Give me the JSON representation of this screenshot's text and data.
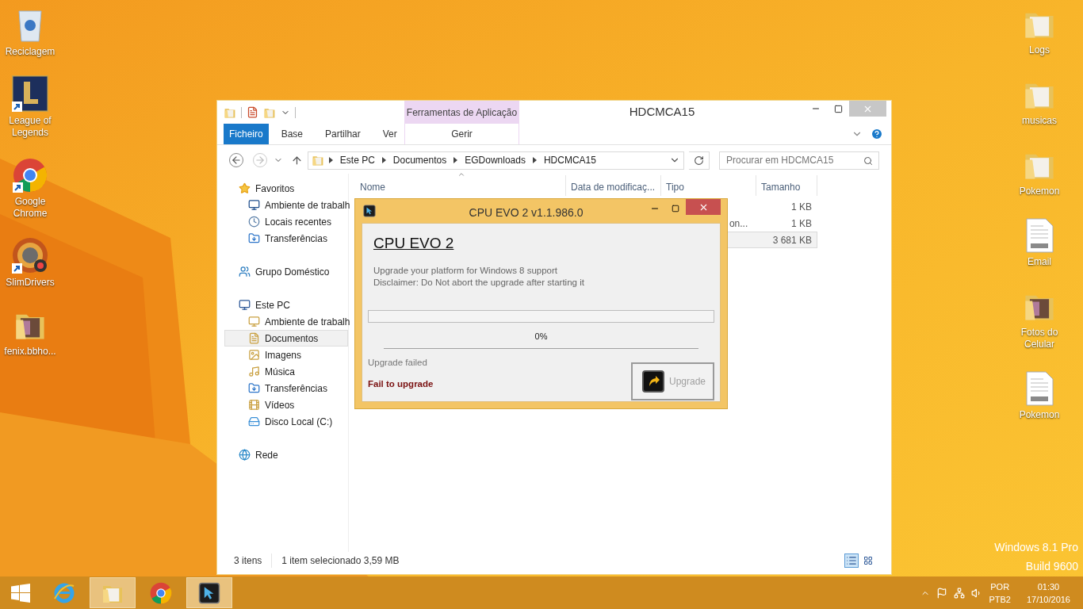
{
  "desktop_left": [
    {
      "label": "Reciclagem",
      "kind": "recycle-bin",
      "shortcut": false
    },
    {
      "label": "League of Legends",
      "kind": "game",
      "shortcut": true
    },
    {
      "label": "Google Chrome",
      "kind": "chrome",
      "shortcut": true
    },
    {
      "label": "SlimDrivers",
      "kind": "app",
      "shortcut": true
    },
    {
      "label": "fenix.bbho...",
      "kind": "photo-folder",
      "shortcut": false
    }
  ],
  "desktop_right": [
    {
      "label": "Logs",
      "kind": "folder",
      "shortcut": false
    },
    {
      "label": "musicas",
      "kind": "folder",
      "shortcut": false
    },
    {
      "label": "Pokemon",
      "kind": "folder",
      "shortcut": false
    },
    {
      "label": "Email",
      "kind": "document",
      "shortcut": false
    },
    {
      "label": "Fotos do Celular",
      "kind": "photo-folder",
      "shortcut": false
    },
    {
      "label": "Pokemon",
      "kind": "document",
      "shortcut": false
    }
  ],
  "explorer": {
    "title": "HDCMCA15",
    "context_group": "Ferramentas de Aplicação",
    "ribbon_tabs": [
      {
        "label": "Ficheiro",
        "kind": "file"
      },
      {
        "label": "Base",
        "kind": "tab"
      },
      {
        "label": "Partilhar",
        "kind": "tab"
      },
      {
        "label": "Ver",
        "kind": "tab"
      },
      {
        "label": "Gerir",
        "kind": "context"
      }
    ],
    "breadcrumb": [
      "Este PC",
      "Documentos",
      "EGDownloads",
      "HDCMCA15"
    ],
    "search": {
      "placeholder": "Procurar em HDCMCA15"
    },
    "sidebar": [
      {
        "label": "Favoritos",
        "kind": "favorites",
        "selected": false,
        "children": [
          {
            "label": "Ambiente de trabalh",
            "kind": "desktop",
            "selected": false
          },
          {
            "label": "Locais recentes",
            "kind": "recent",
            "selected": false
          },
          {
            "label": "Transferências",
            "kind": "downloads",
            "selected": false
          }
        ]
      },
      {
        "label": "Grupo Doméstico",
        "kind": "homegroup",
        "selected": false
      },
      {
        "label": "Este PC",
        "kind": "pc",
        "selected": false,
        "children": [
          {
            "label": "Ambiente de trabalh",
            "kind": "desktop-folder",
            "selected": false
          },
          {
            "label": "Documentos",
            "kind": "documents",
            "selected": true
          },
          {
            "label": "Imagens",
            "kind": "pictures",
            "selected": false
          },
          {
            "label": "Música",
            "kind": "music",
            "selected": false
          },
          {
            "label": "Transferências",
            "kind": "downloads",
            "selected": false
          },
          {
            "label": "Vídeos",
            "kind": "videos",
            "selected": false
          },
          {
            "label": "Disco Local (C:)",
            "kind": "drive",
            "selected": false
          }
        ]
      },
      {
        "label": "Rede",
        "kind": "network",
        "selected": false
      }
    ],
    "columns": [
      "Nome",
      "Data de modificaç...",
      "Tipo",
      "Tamanho"
    ],
    "rows": [
      {
        "type": "",
        "size": "1 KB",
        "selected": false
      },
      {
        "type": "on...",
        "size": "1 KB",
        "selected": false
      },
      {
        "type": "",
        "size": "3 681 KB",
        "selected": true
      }
    ],
    "status": [
      "3 itens",
      "1 item selecionado 3,59 MB"
    ]
  },
  "dialog": {
    "title": "CPU EVO 2 v1.1.986.0",
    "heading": "CPU EVO 2",
    "lines": [
      "Upgrade your platform for Windows 8 support",
      "Disclaimer: Do Not abort the upgrade after starting it"
    ],
    "progress": {
      "level": 0,
      "reading": "0%"
    },
    "status": "Upgrade failed",
    "error": "Fail to upgrade",
    "button": {
      "label": "Upgrade",
      "disabled": true
    }
  },
  "os_build": [
    "Windows 8.1 Pro",
    "Build 9600"
  ],
  "taskbar": {
    "apps": [
      {
        "kind": "ie",
        "running": false
      },
      {
        "kind": "explorer",
        "running": true
      },
      {
        "kind": "chrome",
        "running": false
      },
      {
        "kind": "cpuevo",
        "running": true
      }
    ],
    "tray": {
      "language": "POR",
      "layout": "PTB2",
      "time": "01:30",
      "date": "17/10/2016"
    }
  }
}
